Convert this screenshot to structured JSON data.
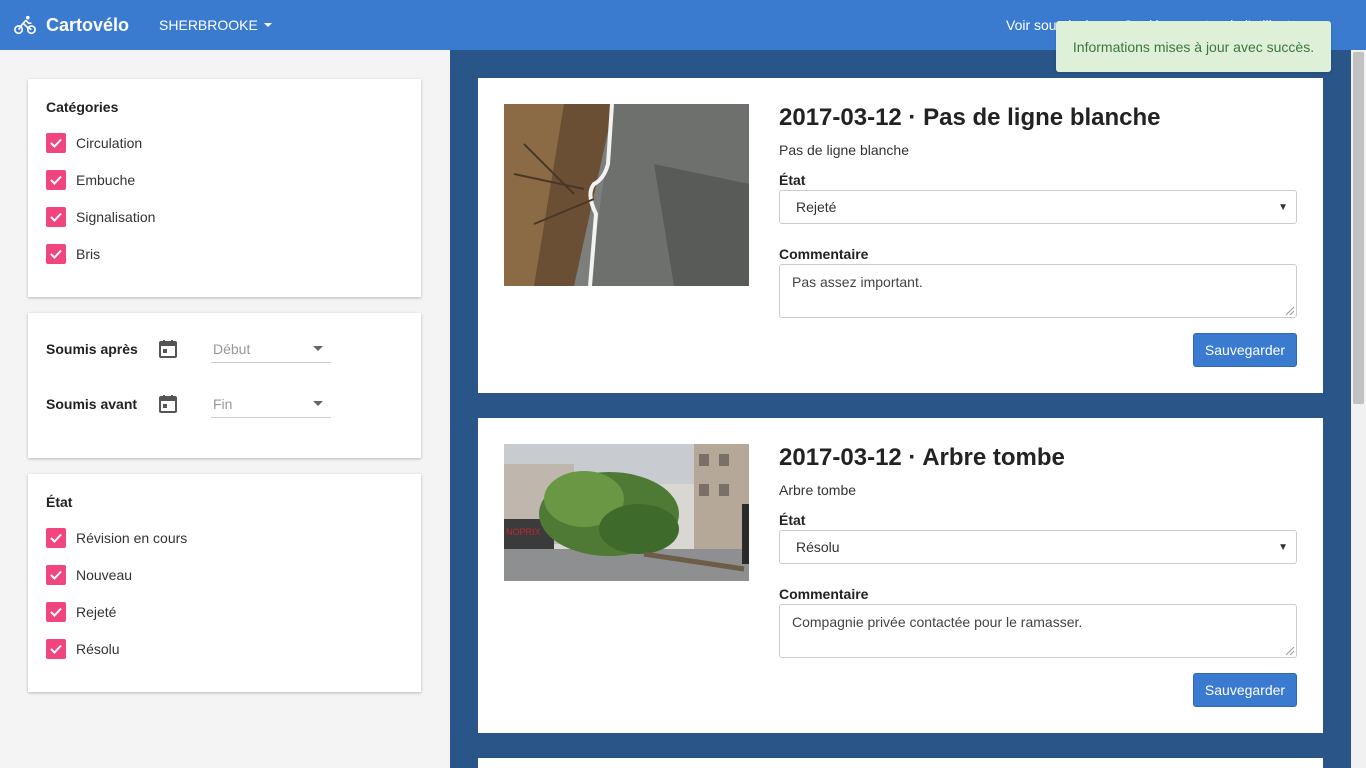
{
  "app": {
    "brand": "Cartovélo",
    "city": "SHERBROOKE",
    "nav_right": "Voir soumissions · Se déconnecter de l'utilisateur"
  },
  "toast": {
    "message": "Informations mises à jour avec succès."
  },
  "sidebar": {
    "categories": {
      "title": "Catégories",
      "items": [
        {
          "label": "Circulation",
          "checked": true
        },
        {
          "label": "Embuche",
          "checked": true
        },
        {
          "label": "Signalisation",
          "checked": true
        },
        {
          "label": "Bris",
          "checked": true
        }
      ]
    },
    "dates": {
      "after_label": "Soumis après",
      "after_placeholder": "Début",
      "before_label": "Soumis avant",
      "before_placeholder": "Fin"
    },
    "state": {
      "title": "État",
      "items": [
        {
          "label": "Révision en cours",
          "checked": true
        },
        {
          "label": "Nouveau",
          "checked": true
        },
        {
          "label": "Rejeté",
          "checked": true
        },
        {
          "label": "Résolu",
          "checked": true
        }
      ]
    }
  },
  "reports": [
    {
      "title": "2017-03-12 · Pas de ligne blanche",
      "description": "Pas de ligne blanche",
      "state_label": "État",
      "state_value": "Rejeté",
      "comment_label": "Commentaire",
      "comment": "Pas assez important.",
      "save_label": "Sauvegarder"
    },
    {
      "title": "2017-03-12 · Arbre tombe",
      "description": "Arbre tombe",
      "state_label": "État",
      "state_value": "Résolu",
      "comment_label": "Commentaire",
      "comment": "Compagnie privée contactée pour le ramasser.",
      "save_label": "Sauvegarder"
    }
  ],
  "colors": {
    "navbar": "#3a7bd0",
    "main_bg": "#2a5588",
    "checkbox": "#f0457f",
    "toast_bg": "#dff0d8",
    "toast_text": "#3c763d"
  }
}
